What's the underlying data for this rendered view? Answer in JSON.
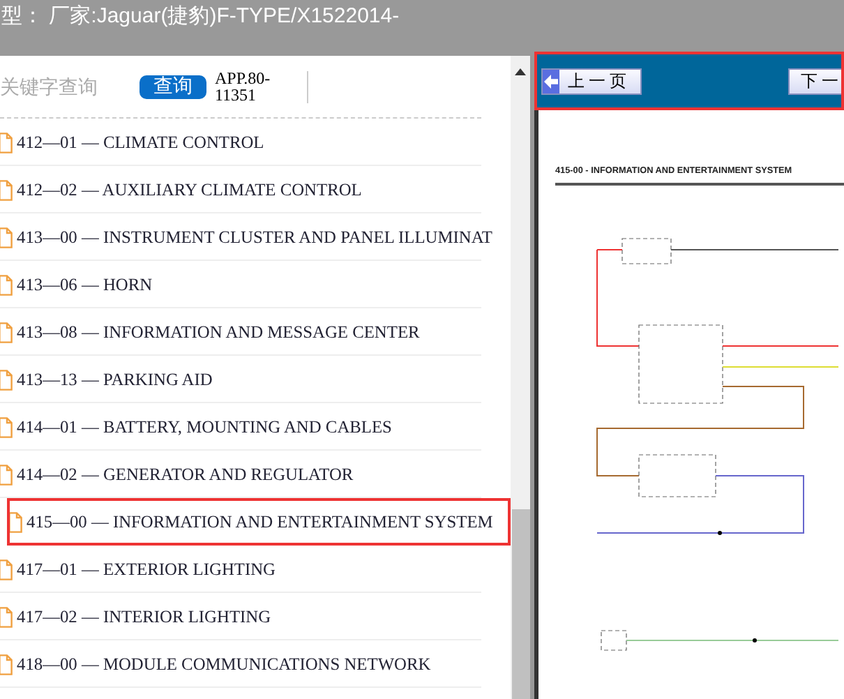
{
  "window": {
    "title": "型： 厂家:Jaguar(捷豹)F-TYPE/X1522014-"
  },
  "search": {
    "placeholder": "关键字查询",
    "button": "查询",
    "app_code": "APP.80-11351"
  },
  "items": [
    {
      "label": "412—01 — CLIMATE CONTROL",
      "selected": false
    },
    {
      "label": "412—02 — AUXILIARY CLIMATE CONTROL",
      "selected": false
    },
    {
      "label": "413—00 — INSTRUMENT CLUSTER AND PANEL ILLUMINAT",
      "selected": false
    },
    {
      "label": "413—06 — HORN",
      "selected": false
    },
    {
      "label": "413—08 — INFORMATION AND MESSAGE CENTER",
      "selected": false
    },
    {
      "label": "413—13 — PARKING AID",
      "selected": false
    },
    {
      "label": "414—01 — BATTERY, MOUNTING AND CABLES",
      "selected": false
    },
    {
      "label": "414—02 — GENERATOR AND REGULATOR",
      "selected": false
    },
    {
      "label": "415—00 — INFORMATION AND ENTERTAINMENT SYSTEM",
      "selected": true
    },
    {
      "label": "417—01 — EXTERIOR LIGHTING",
      "selected": false
    },
    {
      "label": "417—02 — INTERIOR LIGHTING",
      "selected": false
    },
    {
      "label": "418—00 — MODULE COMMUNICATIONS NETWORK",
      "selected": false
    }
  ],
  "viewer": {
    "prev_button": "上一页",
    "next_button": "下一",
    "heading": "415-00 - INFORMATION AND ENTERTAINMENT SYSTEM"
  }
}
